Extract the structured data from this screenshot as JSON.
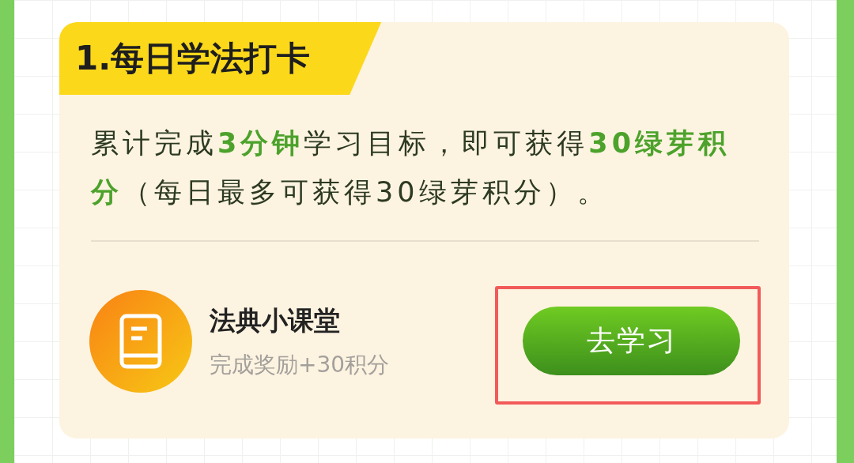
{
  "task": {
    "title": "1.每日学法打卡",
    "description": "累计完成**3分钟**学习目标，即可获得**30绿芽积分**（每日最多可获得30绿芽积分）。"
  },
  "course": {
    "name": "法典小课堂",
    "reward": "完成奖励+30积分",
    "button": {
      "label": "去学习",
      "highlighted": true
    }
  }
}
